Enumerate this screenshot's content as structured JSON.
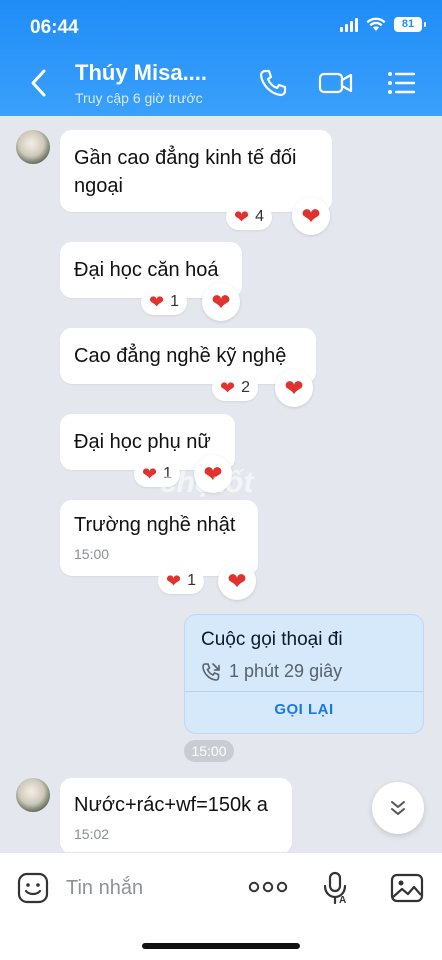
{
  "status_bar": {
    "time": "06:44",
    "battery": "81"
  },
  "header": {
    "contact_name": "Thúy Misa....",
    "contact_status": "Truy cập 6 giờ trước"
  },
  "messages": [
    {
      "text": "Gần cao đẳng kinh tế đối ngoại",
      "reaction_count": "4"
    },
    {
      "text": "Đại học căn hoá",
      "reaction_count": "1"
    },
    {
      "text": "Cao đẳng nghề kỹ nghệ",
      "reaction_count": "2"
    },
    {
      "text": "Đại học phụ nữ",
      "reaction_count": "1"
    },
    {
      "text": "Trường nghề nhật",
      "time": "15:00",
      "reaction_count": "1"
    },
    {
      "text": "Nước+rác+wf=150k a",
      "time": "15:02"
    }
  ],
  "call_card": {
    "title": "Cuộc gọi thoại đi",
    "duration": "1 phút 29 giây",
    "action": "GỌI LẠI"
  },
  "time_chip": "15:00",
  "watermark": "chợtốt",
  "composer": {
    "placeholder": "Tin nhắn"
  },
  "colors": {
    "header": "#1f8cf7",
    "heart": "#e0322f",
    "call_card_bg": "#d5e9fb",
    "action_blue": "#1a78e6"
  }
}
